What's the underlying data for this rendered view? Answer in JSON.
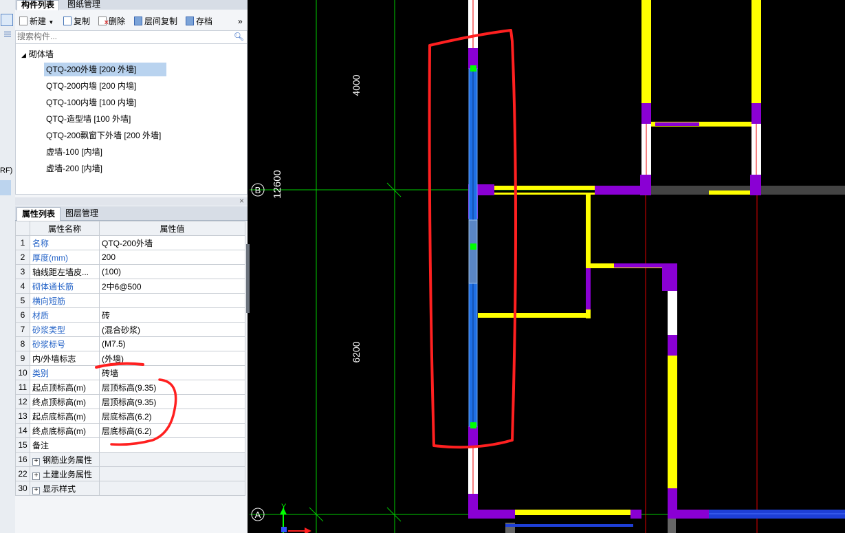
{
  "side": {
    "label": "RF)"
  },
  "component_panel": {
    "tabs": [
      "构件列表",
      "图纸管理"
    ],
    "toolbar": {
      "new": "新建",
      "copy": "复制",
      "delete": "删除",
      "floor_copy": "层间复制",
      "save": "存档",
      "more": "»"
    },
    "search": {
      "placeholder": "搜索构件..."
    },
    "tree": {
      "root": "砌体墙",
      "items": [
        "QTQ-200外墙 [200 外墙]",
        "QTQ-200内墙 [200 内墙]",
        "QTQ-100内墙 [100 内墙]",
        "QTQ-造型墙 [100 外墙]",
        "QTQ-200飘窗下外墙 [200 外墙]",
        "虚墙-100 [内墙]",
        "虚墙-200 [内墙]"
      ],
      "selected_index": 0
    }
  },
  "property_panel": {
    "tabs": [
      "属性列表",
      "图层管理"
    ],
    "close": "×",
    "headers": {
      "name": "属性名称",
      "value": "属性值"
    },
    "rows": [
      {
        "n": "1",
        "name": "名称",
        "value": "QTQ-200外墙",
        "blue": true
      },
      {
        "n": "2",
        "name": "厚度(mm)",
        "value": "200",
        "blue": true
      },
      {
        "n": "3",
        "name": "轴线距左墙皮...",
        "value": "(100)",
        "blue": false
      },
      {
        "n": "4",
        "name": "砌体通长筋",
        "value": "2中6@500",
        "blue": true
      },
      {
        "n": "5",
        "name": "横向短筋",
        "value": "",
        "blue": true
      },
      {
        "n": "6",
        "name": "材质",
        "value": "砖",
        "blue": true
      },
      {
        "n": "7",
        "name": "砂浆类型",
        "value": "(混合砂浆)",
        "blue": true
      },
      {
        "n": "8",
        "name": "砂浆标号",
        "value": "(M7.5)",
        "blue": true
      },
      {
        "n": "9",
        "name": "内/外墙标志",
        "value": "(外墙)",
        "blue": false
      },
      {
        "n": "10",
        "name": "类别",
        "value": "砖墙",
        "blue": true
      },
      {
        "n": "11",
        "name": "起点顶标高(m)",
        "value": "层顶标高(9.35)",
        "blue": false
      },
      {
        "n": "12",
        "name": "终点顶标高(m)",
        "value": "层顶标高(9.35)",
        "blue": false
      },
      {
        "n": "13",
        "name": "起点底标高(m)",
        "value": "层底标高(6.2)",
        "blue": false
      },
      {
        "n": "14",
        "name": "终点底标高(m)",
        "value": "层底标高(6.2)",
        "blue": false
      },
      {
        "n": "15",
        "name": "备注",
        "value": "",
        "blue": false
      }
    ],
    "groups": [
      {
        "n": "16",
        "name": "钢筋业务属性"
      },
      {
        "n": "22",
        "name": "土建业务属性"
      },
      {
        "n": "30",
        "name": "显示样式"
      }
    ]
  },
  "drawing": {
    "dims": {
      "upper": "4000",
      "lower": "6200",
      "total": "12600"
    },
    "axes": {
      "b": "B",
      "a": "A",
      "y": "Y"
    },
    "colors": {
      "background": "#000000",
      "selected_wall": "#1e6fe6",
      "wall": "#ffff00",
      "column": "#8a00d4",
      "grid": "#00ff00",
      "annotation": "#ff3333",
      "axis_red": "#ff0000"
    }
  }
}
